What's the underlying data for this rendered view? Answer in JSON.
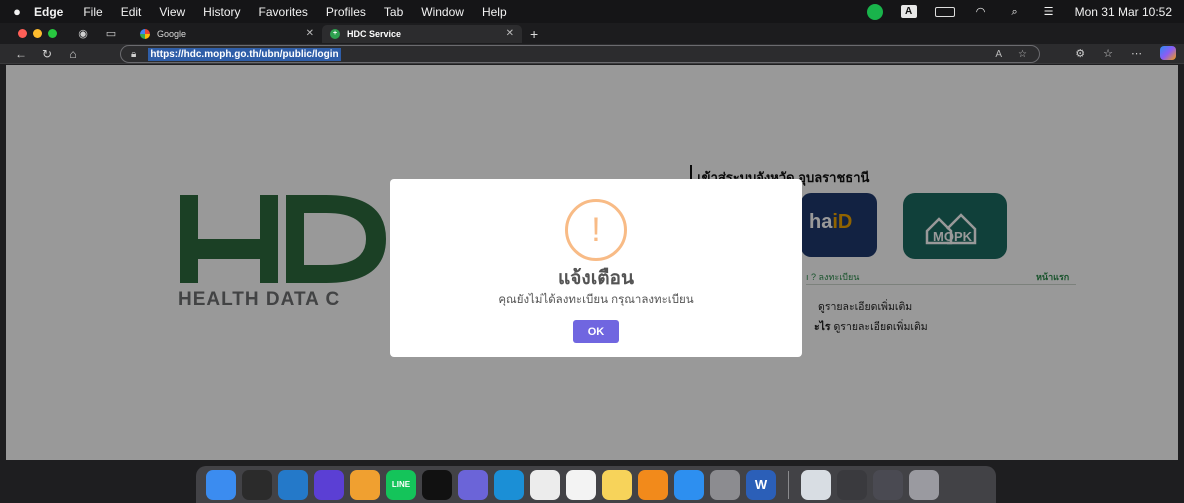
{
  "menubar": {
    "app_name": "Edge",
    "menus": [
      "File",
      "Edit",
      "View",
      "History",
      "Favorites",
      "Profiles",
      "Tab",
      "Window",
      "Help"
    ],
    "icons": [
      "line-status-icon",
      "input-source-icon",
      "battery-icon",
      "wifi-icon",
      "spotlight-icon",
      "control-center-icon"
    ],
    "input_source": "A",
    "clock": "Mon 31 Mar 10:52"
  },
  "tabs": [
    {
      "label": "Google",
      "active": false
    },
    {
      "label": "HDC Service",
      "active": true
    }
  ],
  "address_bar": {
    "url": "https://hdc.moph.go.th/ubn/public/login"
  },
  "page": {
    "logo_text": "HD",
    "tagline": "HEALTH DATA C",
    "province_heading": "เข้าสู่ระบบจังหวัด อุบลราชธานี",
    "thaid_label_main": "ha",
    "thaid_label_accent": "iD",
    "mopk_label": "MOPK",
    "register_prefix": "ı ?",
    "register_link": "ลงทะเบียน",
    "home_link": "หน้าแรก",
    "detail_line_1": "ดูรายละเอียดเพิ่มเติม",
    "detail_line_2_bold": "ะไร",
    "detail_line_2_rest": "ดูรายละเอียดเพิ่มเติม"
  },
  "dialog": {
    "icon": "!",
    "title": "แจ้งเตือน",
    "message": "คุณยังไม่ได้ลงทะเบียน กรุณาลงทะเบียน",
    "ok_label": "OK"
  },
  "dock": {
    "apps": [
      {
        "name": "finder",
        "color": "#3b8cf0",
        "glyph": ""
      },
      {
        "name": "terminal",
        "color": "#2b2b2b",
        "glyph": ""
      },
      {
        "name": "vscode",
        "color": "#2479c9",
        "glyph": ""
      },
      {
        "name": "arc",
        "color": "#5b3fd4",
        "glyph": ""
      },
      {
        "name": "chatgpt-alt",
        "color": "#f0a030",
        "glyph": ""
      },
      {
        "name": "line",
        "color": "#14c45a",
        "glyph": "LINE"
      },
      {
        "name": "chatgpt",
        "color": "#111111",
        "glyph": ""
      },
      {
        "name": "teams",
        "color": "#6b64d8",
        "glyph": ""
      },
      {
        "name": "edge",
        "color": "#1b8fd6",
        "glyph": ""
      },
      {
        "name": "chrome",
        "color": "#ececec",
        "glyph": ""
      },
      {
        "name": "reminders",
        "color": "#f3f3f3",
        "glyph": ""
      },
      {
        "name": "notes",
        "color": "#f7d35a",
        "glyph": ""
      },
      {
        "name": "pages",
        "color": "#f28a1b",
        "glyph": ""
      },
      {
        "name": "app-store",
        "color": "#2d8ff0",
        "glyph": ""
      },
      {
        "name": "system-settings",
        "color": "#8c8c90",
        "glyph": ""
      },
      {
        "name": "word",
        "color": "#2b5fb8",
        "glyph": "W"
      },
      {
        "name": "preview",
        "color": "#d8dde3",
        "glyph": ""
      },
      {
        "name": "downloads-stack",
        "color": "#3a3a3e",
        "glyph": ""
      },
      {
        "name": "screenshot-stack",
        "color": "#4a4a52",
        "glyph": ""
      },
      {
        "name": "trash",
        "color": "#9a9aa0",
        "glyph": ""
      }
    ]
  },
  "colors": {
    "hdc_green": "#2e6b3f",
    "alert_button": "#7066e0",
    "warning_ring": "#f8bb86"
  }
}
